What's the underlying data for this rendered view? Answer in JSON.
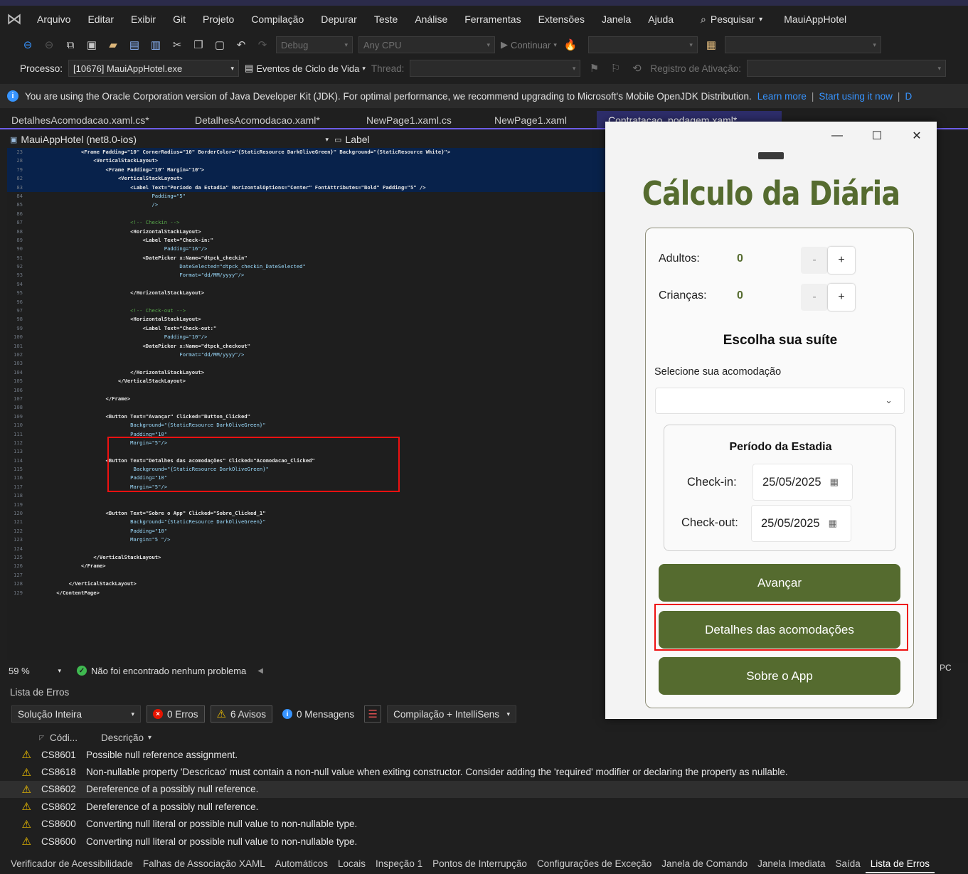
{
  "menubar": {
    "items": [
      "Arquivo",
      "Editar",
      "Exibir",
      "Git",
      "Projeto",
      "Compilação",
      "Depurar",
      "Teste",
      "Análise",
      "Ferramentas",
      "Extensões",
      "Janela",
      "Ajuda"
    ],
    "search_label": "Pesquisar",
    "project_name": "MauiAppHotel"
  },
  "toolbar1": {
    "config": "Debug",
    "platform": "Any CPU",
    "continue_label": "Continuar"
  },
  "toolbar2": {
    "process_label": "Processo:",
    "process_value": "[10676] MauiAppHotel.exe",
    "lifecycle_label": "Eventos de Ciclo de Vida",
    "thread_label": "Thread:",
    "activation_label": "Registro de Ativação:"
  },
  "infobar": {
    "message": "You are using the Oracle Corporation version of Java Developer Kit (JDK). For optimal performance, we recommend upgrading to Microsoft's Mobile OpenJDK Distribution.",
    "learn_more": "Learn more",
    "start_using": "Start using it now",
    "trailing": "D"
  },
  "doc_tabs": [
    "DetalhesAcomodacao.xaml.cs*",
    "DetalhesAcomodacao.xaml*",
    "NewPage1.xaml.cs",
    "NewPage1.xaml",
    "Contratacao_podagem.xaml*"
  ],
  "navbar": {
    "project": "MauiAppHotel (net8.0-ios)",
    "member": "Label"
  },
  "code_lines": [
    {
      "n": "23",
      "t": "            <Frame Padding=\"10\" CornerRadius=\"10\" BorderColor=\"{StaticResource DarkOliveGreen}\" Background=\"{StaticResource White}\">"
    },
    {
      "n": "28",
      "t": "                <VerticalStackLayout>"
    },
    {
      "n": "79",
      "t": "                    <Frame Padding=\"10\" Margin=\"10\">"
    },
    {
      "n": "82",
      "t": "                        <VerticalStackLayout>"
    },
    {
      "n": "83",
      "t": "                            <Label Text=\"Período da Estadia\" HorizontalOptions=\"Center\" FontAttributes=\"Bold\" Padding=\"5\" />"
    },
    {
      "n": "84",
      "t": "                                   Padding=\"5\""
    },
    {
      "n": "85",
      "t": "                                   />"
    },
    {
      "n": "86",
      "t": ""
    },
    {
      "n": "87",
      "t": "                            <!-- Checkin -->"
    },
    {
      "n": "88",
      "t": "                            <HorizontalStackLayout>"
    },
    {
      "n": "89",
      "t": "                                <Label Text=\"Check-in:\""
    },
    {
      "n": "90",
      "t": "                                       Padding=\"16\"/>"
    },
    {
      "n": "91",
      "t": "                                <DatePicker x:Name=\"dtpck_checkin\""
    },
    {
      "n": "92",
      "t": "                                            DateSelected=\"dtpck_checkin_DateSelected\""
    },
    {
      "n": "93",
      "t": "                                            Format=\"dd/MM/yyyy\"/>"
    },
    {
      "n": "94",
      "t": ""
    },
    {
      "n": "95",
      "t": "                            </HorizontalStackLayout>"
    },
    {
      "n": "96",
      "t": ""
    },
    {
      "n": "97",
      "t": "                            <!-- Check-out -->"
    },
    {
      "n": "98",
      "t": "                            <HorizontalStackLayout>"
    },
    {
      "n": "99",
      "t": "                                <Label Text=\"Check-out:\""
    },
    {
      "n": "100",
      "t": "                                       Padding=\"10\"/>"
    },
    {
      "n": "101",
      "t": "                                <DatePicker x:Name=\"dtpck_checkout\""
    },
    {
      "n": "102",
      "t": "                                            Format=\"dd/MM/yyyy\"/>"
    },
    {
      "n": "103",
      "t": ""
    },
    {
      "n": "104",
      "t": "                            </HorizontalStackLayout>"
    },
    {
      "n": "105",
      "t": "                        </VerticalStackLayout>"
    },
    {
      "n": "106",
      "t": ""
    },
    {
      "n": "107",
      "t": "                    </Frame>"
    },
    {
      "n": "108",
      "t": ""
    },
    {
      "n": "109",
      "t": "                    <Button Text=\"Avançar\" Clicked=\"Button_Clicked\""
    },
    {
      "n": "110",
      "t": "                            Background=\"{StaticResource DarkOliveGreen}\""
    },
    {
      "n": "111",
      "t": "                            Padding=\"10\""
    },
    {
      "n": "112",
      "t": "                            Margin=\"5\"/>"
    },
    {
      "n": "113",
      "t": ""
    },
    {
      "n": "114",
      "t": "                    <Button Text=\"Detalhes das acomodações\" Clicked=\"Acomodacao_Clicked\""
    },
    {
      "n": "115",
      "t": "                             Background=\"{StaticResource DarkOliveGreen}\""
    },
    {
      "n": "116",
      "t": "                            Padding=\"10\""
    },
    {
      "n": "117",
      "t": "                            Margin=\"5\"/>"
    },
    {
      "n": "118",
      "t": ""
    },
    {
      "n": "119",
      "t": ""
    },
    {
      "n": "120",
      "t": "                    <Button Text=\"Sobre o App\" Clicked=\"Sobre_Clicked_1\""
    },
    {
      "n": "121",
      "t": "                            Background=\"{StaticResource DarkOliveGreen}\""
    },
    {
      "n": "122",
      "t": "                            Padding=\"10\""
    },
    {
      "n": "123",
      "t": "                            Margin=\"5 \"/>"
    },
    {
      "n": "124",
      "t": ""
    },
    {
      "n": "125",
      "t": "                </VerticalStackLayout>"
    },
    {
      "n": "126",
      "t": "            </Frame>"
    },
    {
      "n": "127",
      "t": ""
    },
    {
      "n": "128",
      "t": "        </VerticalStackLayout>"
    },
    {
      "n": "129",
      "t": "    </ContentPage>"
    }
  ],
  "statusbar": {
    "zoom": "59 %",
    "status": "Não foi encontrado nenhum problema"
  },
  "error_list": {
    "title": "Lista de Erros",
    "scope": "Solução Inteira",
    "errors": "0 Erros",
    "warnings": "6 Avisos",
    "messages": "0 Mensagens",
    "build_filter": "Compilação + IntelliSens",
    "col_code": "Códi...",
    "col_desc": "Descrição",
    "rows": [
      {
        "code": "CS8601",
        "desc": "Possible null reference assignment."
      },
      {
        "code": "CS8618",
        "desc": "Non-nullable property 'Descricao' must contain a non-null value when exiting constructor. Consider adding the 'required' modifier or declaring the property as nullable."
      },
      {
        "code": "CS8602",
        "desc": "Dereference of a possibly null reference."
      },
      {
        "code": "CS8602",
        "desc": "Dereference of a possibly null reference."
      },
      {
        "code": "CS8600",
        "desc": "Converting null literal or possible null value to non-nullable type."
      },
      {
        "code": "CS8600",
        "desc": "Converting null literal or possible null value to non-nullable type."
      }
    ]
  },
  "bottom_tabs": [
    "Verificador de Acessibilidade",
    "Falhas de Associação XAML",
    "Automáticos",
    "Locais",
    "Inspeção 1",
    "Pontos de Interrupção",
    "Configurações de Exceção",
    "Janela de Comando",
    "Janela Imediata",
    "Saída",
    "Lista de Erros"
  ],
  "app": {
    "title": "Cálculo da Diária",
    "adults_label": "Adultos:",
    "adults_value": "0",
    "children_label": "Crianças:",
    "children_value": "0",
    "minus": "-",
    "plus": "+",
    "suite_title": "Escolha sua suíte",
    "select_label": "Selecione sua acomodação",
    "period_title": "Período da Estadia",
    "checkin_label": "Check-in:",
    "checkin_value": "25/05/2025",
    "checkout_label": "Check-out:",
    "checkout_value": "25/05/2025",
    "btn_next": "Avançar",
    "btn_details": "Detalhes das acomodações",
    "btn_about": "Sobre o App",
    "accent_color": "#556b2f"
  },
  "side_pc": "PC"
}
